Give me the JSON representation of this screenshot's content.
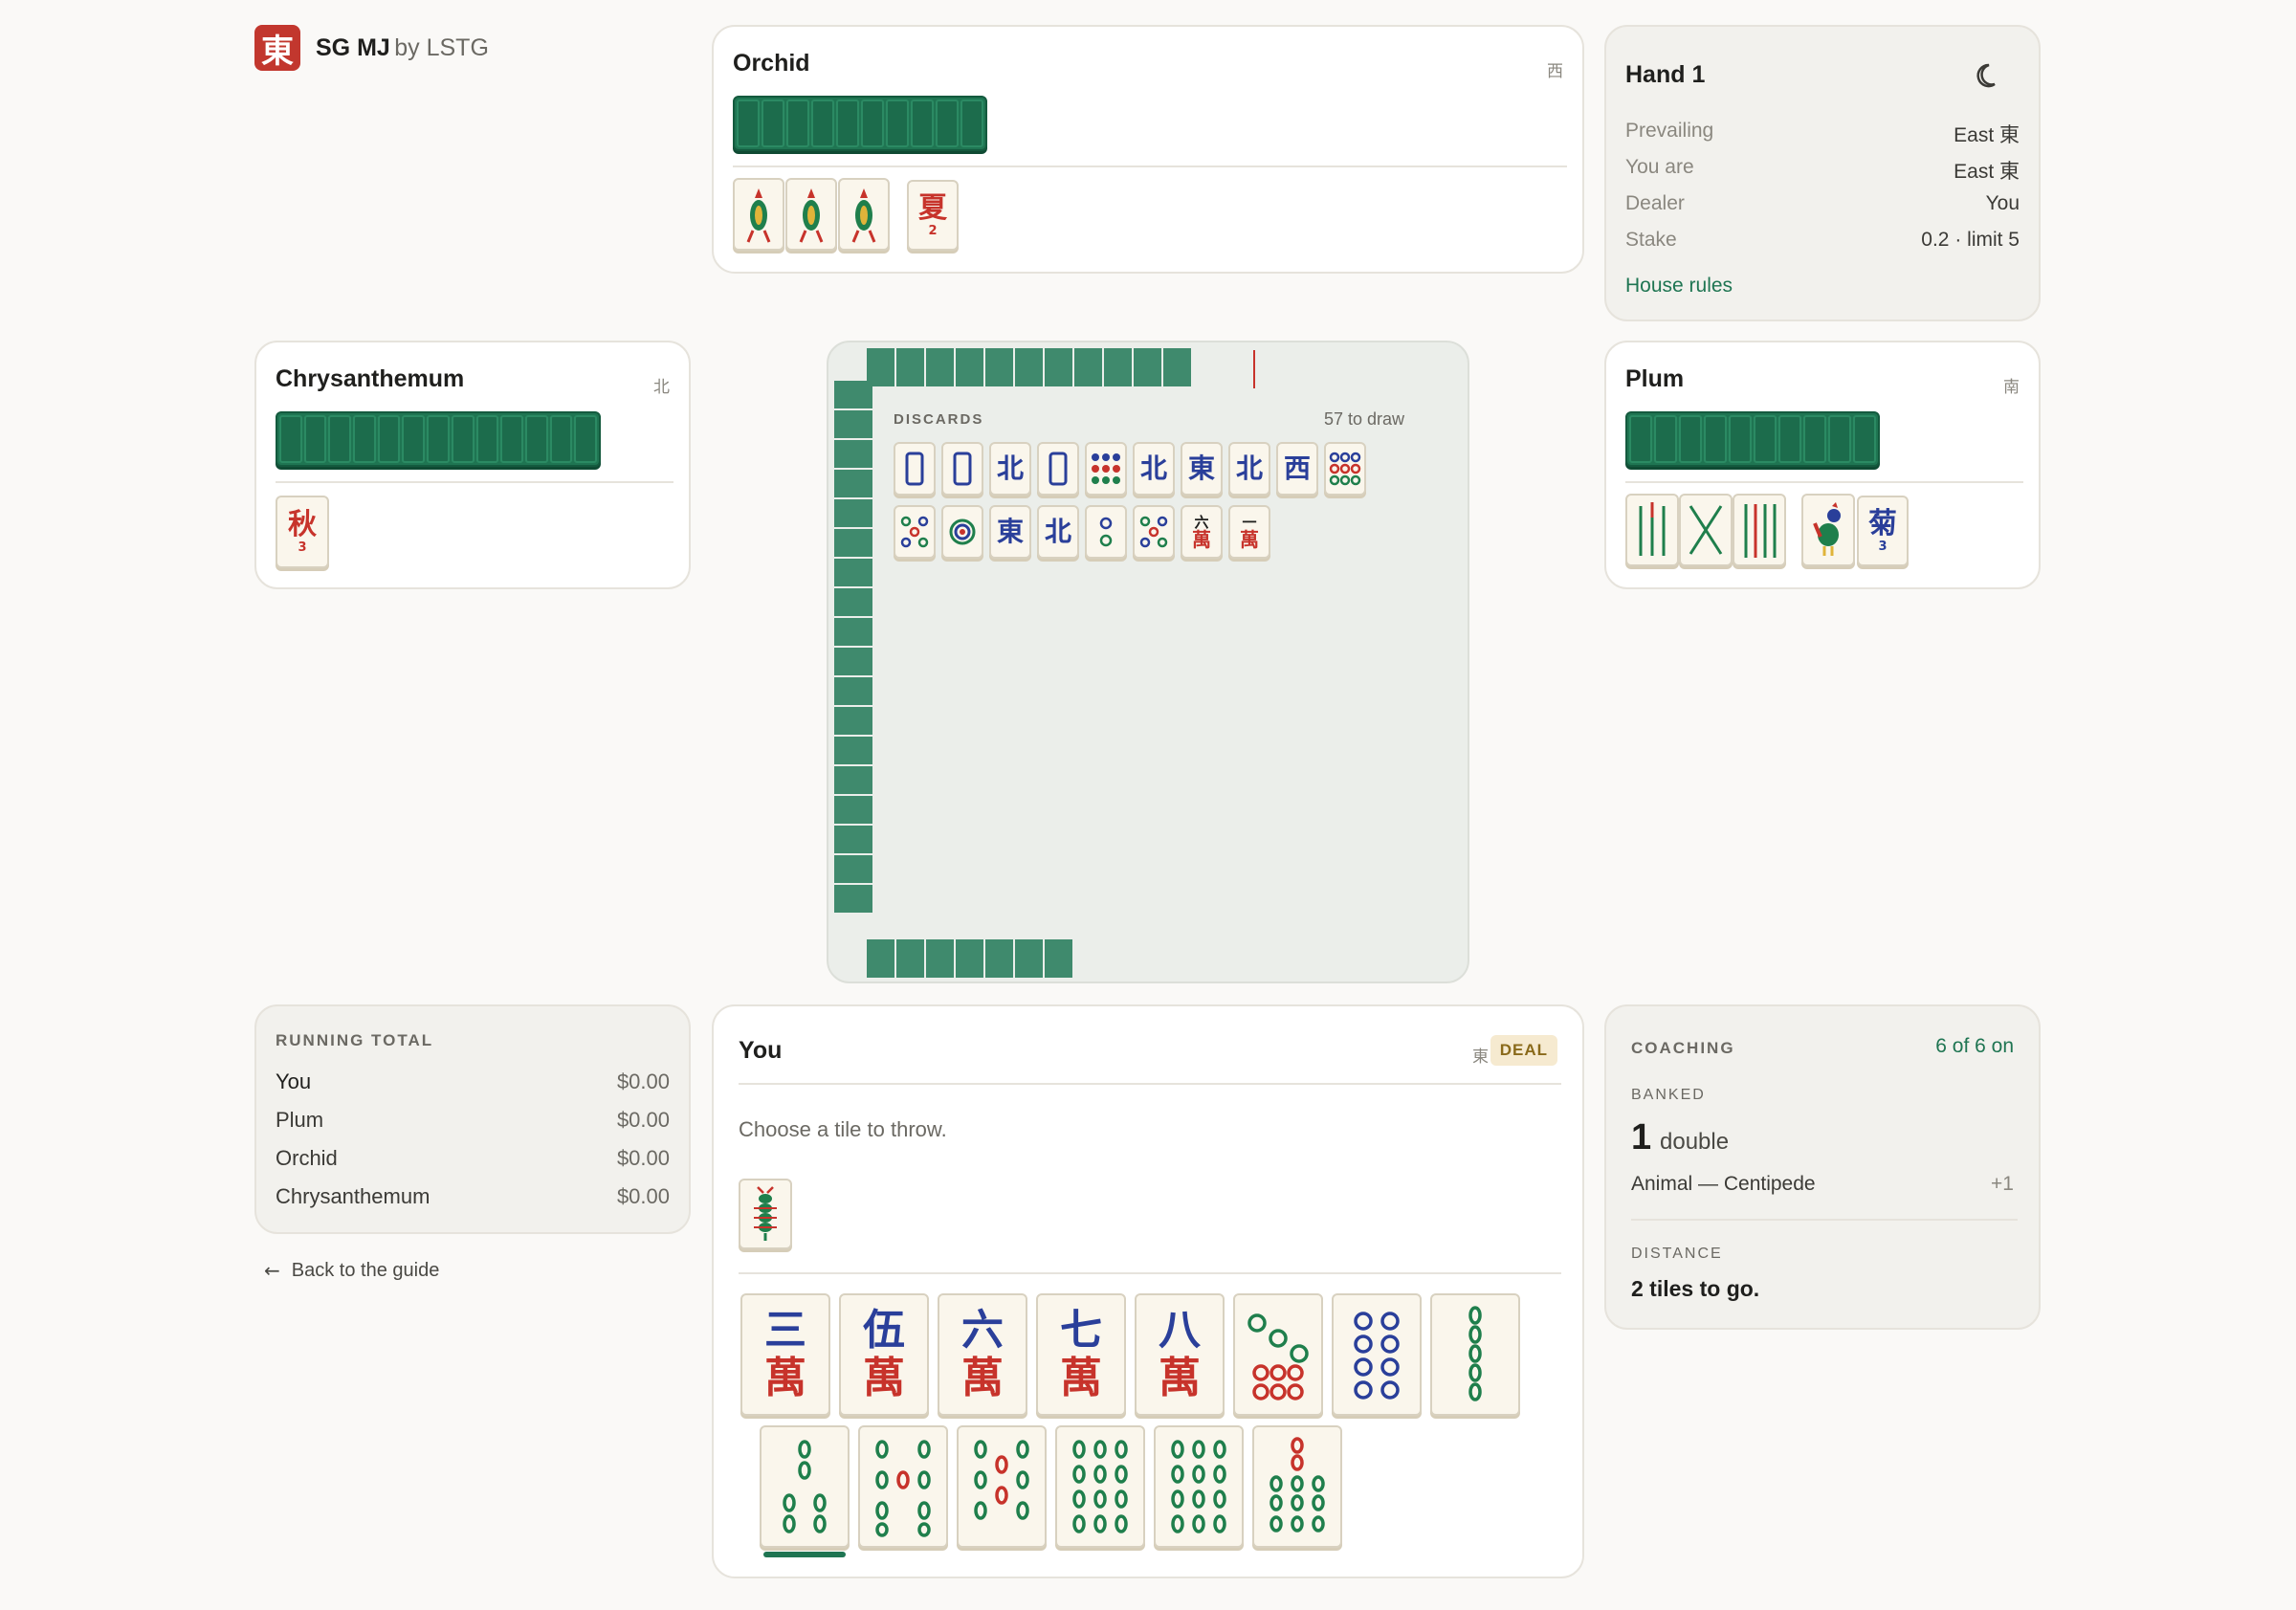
{
  "app": {
    "logo_glyph": "東",
    "title": "SG MJ",
    "subtitle": "by LSTG"
  },
  "players": {
    "top": {
      "name": "Orchid",
      "wind": "西",
      "bonus": [
        {
          "kind": "animal",
          "icon": "cockerel-icon"
        },
        {
          "kind": "animal",
          "icon": "cockerel-icon"
        },
        {
          "kind": "animal",
          "icon": "cockerel-icon"
        },
        {
          "kind": "flower",
          "char": "夏",
          "num": "2"
        }
      ]
    },
    "left": {
      "name": "Chrysanthemum",
      "wind": "北",
      "bonus": [
        {
          "kind": "flower",
          "char": "秋",
          "num": "3"
        }
      ]
    },
    "right": {
      "name": "Plum",
      "wind": "南",
      "bonus": [
        {
          "kind": "bamboo",
          "label": "bamboo-tile"
        },
        {
          "kind": "bamboo",
          "label": "bamboo-tile"
        },
        {
          "kind": "bamboo",
          "label": "bamboo-tile"
        },
        {
          "kind": "animal",
          "icon": "rooster-icon"
        },
        {
          "kind": "flower",
          "char": "菊",
          "num": "3"
        }
      ]
    }
  },
  "hand_info": {
    "title": "Hand 1",
    "rows": [
      {
        "k": "Prevailing",
        "v": "East 東"
      },
      {
        "k": "You are",
        "v": "East 東"
      },
      {
        "k": "Dealer",
        "v": "You"
      },
      {
        "k": "Stake",
        "v": "0.2 · limit 5"
      }
    ],
    "link": "House rules"
  },
  "table": {
    "discards_label": "DISCARDS",
    "to_draw": "57 to draw",
    "discards_row1": [
      "🀆",
      "🀆",
      "北",
      "🀆",
      "●",
      "北",
      "東",
      "北",
      "西",
      "●"
    ],
    "discards_row2": [
      "●",
      "◎",
      "東",
      "北",
      "◎",
      "●",
      "六萬",
      "一萬"
    ]
  },
  "running_total": {
    "label": "RUNNING TOTAL",
    "rows": [
      {
        "name": "You",
        "amount": "$0.00"
      },
      {
        "name": "Plum",
        "amount": "$0.00"
      },
      {
        "name": "Orchid",
        "amount": "$0.00"
      },
      {
        "name": "Chrysanthemum",
        "amount": "$0.00"
      }
    ],
    "back_link": "Back to the guide"
  },
  "you": {
    "name": "You",
    "wind": "東",
    "badge": "DEAL",
    "prompt": "Choose a tile to throw.",
    "hand_row1": [
      {
        "top": "三",
        "bottom": "萬"
      },
      {
        "top": "伍",
        "bottom": "萬"
      },
      {
        "top": "六",
        "bottom": "萬"
      },
      {
        "top": "七",
        "bottom": "萬"
      },
      {
        "top": "八",
        "bottom": "萬"
      }
    ]
  },
  "coaching": {
    "label": "COACHING",
    "status": "6 of 6 on",
    "banked_label": "BANKED",
    "banked_count": "1",
    "banked_unit": "double",
    "item": "Animal — Centipede",
    "item_value": "+1",
    "distance_label": "DISTANCE",
    "distance": "2 tiles to go."
  },
  "colors": {
    "accent": "#1f7552",
    "red": "#c7332b",
    "blue": "#2a3f9a",
    "badge_bg": "#f6ead0"
  }
}
